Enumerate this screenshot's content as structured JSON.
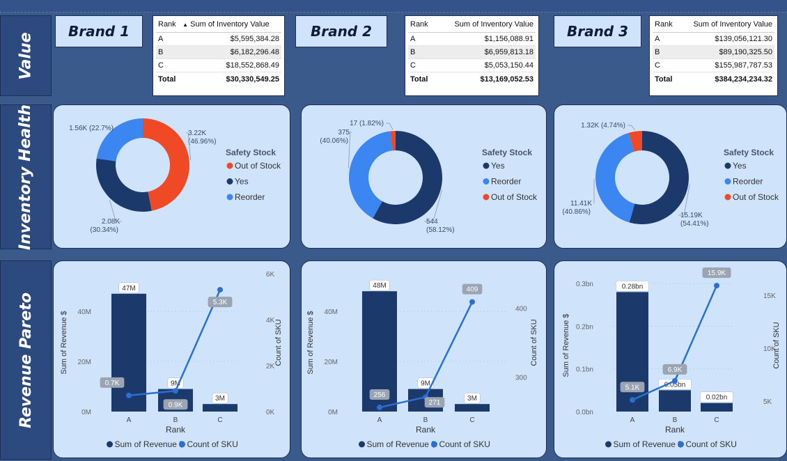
{
  "row_labels": {
    "value": "Value",
    "inventory_health": "Inventory Health",
    "revenue_pareto": "Revenue Pareto"
  },
  "brands": [
    {
      "name": "Brand 1",
      "table": {
        "col_rank": "Rank",
        "col_value": "Sum of Inventory Value",
        "rows": [
          {
            "rank": "A",
            "value": "$5,595,384.28"
          },
          {
            "rank": "B",
            "value": "$6,182,296.48"
          },
          {
            "rank": "C",
            "value": "$18,552,868.49"
          }
        ],
        "total_label": "Total",
        "total_value": "$30,330,549.25"
      }
    },
    {
      "name": "Brand 2",
      "table": {
        "col_rank": "Rank",
        "col_value": "Sum of Inventory Value",
        "rows": [
          {
            "rank": "A",
            "value": "$1,156,088.91"
          },
          {
            "rank": "B",
            "value": "$6,959,813.18"
          },
          {
            "rank": "C",
            "value": "$5,053,150.44"
          }
        ],
        "total_label": "Total",
        "total_value": "$13,169,052.53"
      }
    },
    {
      "name": "Brand 3",
      "table": {
        "col_rank": "Rank",
        "col_value": "Sum of Inventory Value",
        "rows": [
          {
            "rank": "A",
            "value": "$139,056,121.30"
          },
          {
            "rank": "B",
            "value": "$89,190,325.50"
          },
          {
            "rank": "C",
            "value": "$155,987,787.53"
          }
        ],
        "total_label": "Total",
        "total_value": "$384,234,234.32"
      }
    }
  ],
  "colors": {
    "yes": "#1b3a6b",
    "reorder": "#3b86f0",
    "out_of_stock": "#ef4a25",
    "bar": "#1b3a6b",
    "line": "#2a6fd1"
  },
  "chart_data": [
    {
      "type": "pie",
      "variant": "donut",
      "legend_title": "Safety Stock",
      "legend": [
        "Out of Stock",
        "Yes",
        "Reorder"
      ],
      "slices": [
        {
          "name": "Out of Stock",
          "value": 3220,
          "label": "3.22K",
          "pct": "(46.96%)"
        },
        {
          "name": "Yes",
          "value": 2080,
          "label": "2.08K",
          "pct": "(30.34%)"
        },
        {
          "name": "Reorder",
          "value": 1560,
          "label": "1.56K (22.7%)",
          "pct": ""
        }
      ]
    },
    {
      "type": "pie",
      "variant": "donut",
      "legend_title": "Safety Stock",
      "legend": [
        "Yes",
        "Reorder",
        "Out of Stock"
      ],
      "slices": [
        {
          "name": "Yes",
          "value": 544,
          "label": "544",
          "pct": "(58.12%)"
        },
        {
          "name": "Reorder",
          "value": 375,
          "label": "375",
          "pct": "(40.06%)"
        },
        {
          "name": "Out of Stock",
          "value": 17,
          "label": "17 (1.82%)",
          "pct": ""
        }
      ]
    },
    {
      "type": "pie",
      "variant": "donut",
      "legend_title": "Safety Stock",
      "legend": [
        "Yes",
        "Reorder",
        "Out of Stock"
      ],
      "slices": [
        {
          "name": "Yes",
          "value": 15190,
          "label": "15.19K",
          "pct": "(54.41%)"
        },
        {
          "name": "Reorder",
          "value": 11410,
          "label": "11.41K",
          "pct": "(40.86%)"
        },
        {
          "name": "Out of Stock",
          "value": 1320,
          "label": "1.32K (4.74%)",
          "pct": ""
        }
      ]
    },
    {
      "type": "bar",
      "combo": "line",
      "categories": [
        "A",
        "B",
        "C"
      ],
      "xlabel": "Rank",
      "ylabel": "Sum of Revenue $",
      "y2label": "Count of SKU",
      "ylim": [
        0,
        55000000
      ],
      "y_ticks": [
        0,
        20000000,
        40000000
      ],
      "y_tick_labels": [
        "0M",
        "20M",
        "40M"
      ],
      "y2lim": [
        0,
        6000
      ],
      "y2_ticks": [
        0,
        2000,
        4000,
        6000
      ],
      "y2_tick_labels": [
        "0K",
        "2K",
        "4K",
        "6K"
      ],
      "series": [
        {
          "name": "Sum of Revenue $",
          "values": [
            47000000,
            9000000,
            3000000
          ],
          "labels": [
            "47M",
            "9M",
            "3M"
          ]
        },
        {
          "name": "Count of SKU",
          "values": [
            700,
            900,
            5300
          ],
          "labels": [
            "0.7K",
            "0.9K",
            "5.3K"
          ]
        }
      ],
      "legend": [
        "Sum of Revenue $",
        "Count of SKU"
      ]
    },
    {
      "type": "bar",
      "combo": "line",
      "categories": [
        "A",
        "B",
        "C"
      ],
      "xlabel": "Rank",
      "ylabel": "Sum of Revenue $",
      "y2label": "Count of SKU",
      "ylim": [
        0,
        55000000
      ],
      "y_ticks": [
        0,
        20000000,
        40000000
      ],
      "y_tick_labels": [
        "0M",
        "20M",
        "40M"
      ],
      "y2lim": [
        250,
        450
      ],
      "y2_ticks": [
        300,
        400
      ],
      "y2_tick_labels": [
        "300",
        "400"
      ],
      "series": [
        {
          "name": "Sum of Revenue $",
          "values": [
            48000000,
            9000000,
            3000000
          ],
          "labels": [
            "48M",
            "9M",
            "3M"
          ]
        },
        {
          "name": "Count of SKU",
          "values": [
            256,
            271,
            409
          ],
          "labels": [
            "256",
            "271",
            "409"
          ]
        }
      ],
      "legend": [
        "Sum of Revenue $",
        "Count of SKU"
      ]
    },
    {
      "type": "bar",
      "combo": "line",
      "categories": [
        "A",
        "B",
        "C"
      ],
      "xlabel": "Rank",
      "ylabel": "Sum of Revenue $",
      "y2label": "Count of SKU",
      "ylim": [
        0,
        0.31
      ],
      "y_ticks": [
        0,
        0.1,
        0.2,
        0.3
      ],
      "y_tick_labels": [
        "0.0bn",
        "0.1bn",
        "0.2bn",
        "0.3bn"
      ],
      "y2lim": [
        4000,
        16500
      ],
      "y2_ticks": [
        5000,
        10000,
        15000
      ],
      "y2_tick_labels": [
        "5K",
        "10K",
        "15K"
      ],
      "series": [
        {
          "name": "Sum of Revenue $",
          "values": [
            0.28,
            0.05,
            0.02
          ],
          "labels": [
            "0.28bn",
            "0.05bn",
            "0.02bn"
          ]
        },
        {
          "name": "Count of SKU",
          "values": [
            5100,
            6900,
            15900
          ],
          "labels": [
            "5.1K",
            "6.9K",
            "15.9K"
          ]
        }
      ],
      "legend": [
        "Sum of Revenue $",
        "Count of SKU"
      ]
    }
  ]
}
